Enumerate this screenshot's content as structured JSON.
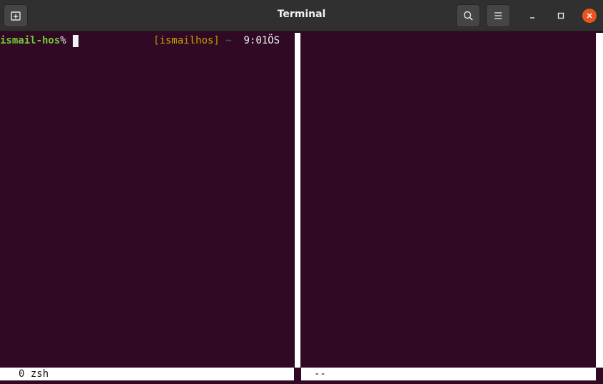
{
  "window": {
    "title": "Terminal"
  },
  "header": {
    "new_tab_icon": "new-tab-icon",
    "search_icon": "search-icon",
    "menu_icon": "hamburger-menu-icon",
    "minimize_icon": "minimize-icon",
    "maximize_icon": "maximize-icon",
    "close_icon": "close-icon"
  },
  "left_pane": {
    "user": "ismail-hos",
    "prompt_symbol": "%",
    "rprompt_open": "[",
    "rprompt_host": "ismailhos",
    "rprompt_close": "]",
    "rprompt_dir": "~",
    "clock": "9:01ÖS"
  },
  "statusbar": {
    "left_text": "0 zsh",
    "right_text": "--"
  },
  "colors": {
    "terminal_bg": "#300a24",
    "titlebar_bg": "#303030",
    "user_green": "#73c936",
    "host_yellow": "#c4a000",
    "dir_blue": "#3465a4",
    "close_orange": "#e95420"
  }
}
